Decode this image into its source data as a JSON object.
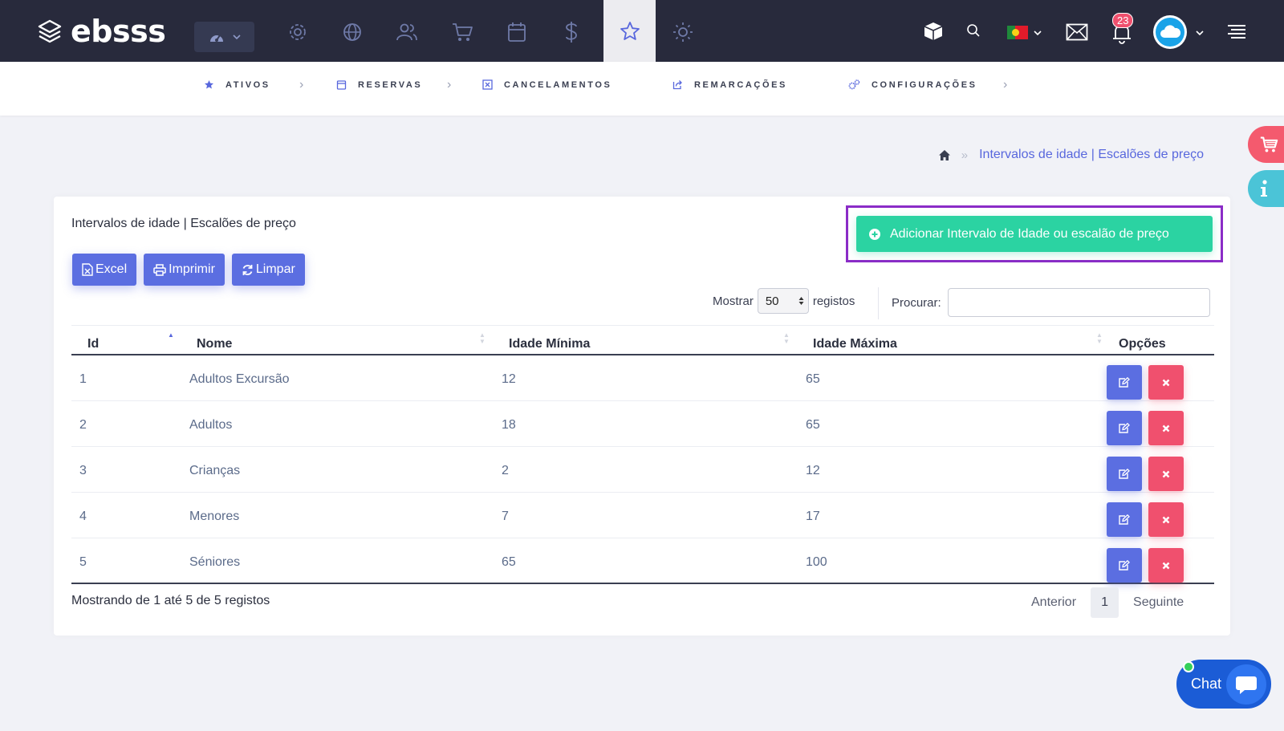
{
  "brand": {
    "name": "ebsss"
  },
  "topbar": {
    "icons": [
      "dashboard-icon",
      "gear-icon",
      "globe-icon",
      "users-icon",
      "cart-icon",
      "calendar-icon",
      "dollar-icon",
      "star-icon",
      "sun-icon"
    ],
    "active": "star-icon",
    "notifications_count": "23"
  },
  "subnav": {
    "items": [
      {
        "label": "ATIVOS",
        "icon": "star-icon"
      },
      {
        "label": "RESERVAS",
        "icon": "calendar-icon"
      },
      {
        "label": "CANCELAMENTOS",
        "icon": "cancel-icon"
      },
      {
        "label": "REMARCAÇÕES",
        "icon": "share-icon"
      },
      {
        "label": "CONFIGURAÇÕES",
        "icon": "cogs-icon"
      }
    ]
  },
  "breadcrumb": {
    "current": "Intervalos de idade | Escalões de preço"
  },
  "card": {
    "title": "Intervalos de idade | Escalões de preço",
    "add_button": "Adicionar Intervalo de Idade ou escalão de preço",
    "tools": {
      "excel": "Excel",
      "print": "Imprimir",
      "clear": "Limpar"
    },
    "show_label": "Mostrar",
    "show_value": "50",
    "show_suffix": "registos",
    "search_label": "Procurar:",
    "search_value": ""
  },
  "table": {
    "headers": {
      "id": "Id",
      "name": "Nome",
      "min": "Idade Mínima",
      "max": "Idade Máxima",
      "options": "Opções"
    },
    "rows": [
      {
        "id": "1",
        "name": "Adultos Excursão",
        "min": "12",
        "max": "65"
      },
      {
        "id": "2",
        "name": "Adultos",
        "min": "18",
        "max": "65"
      },
      {
        "id": "3",
        "name": "Crianças",
        "min": "2",
        "max": "12"
      },
      {
        "id": "4",
        "name": "Menores",
        "min": "7",
        "max": "17"
      },
      {
        "id": "5",
        "name": "Séniores",
        "min": "65",
        "max": "100"
      }
    ]
  },
  "footer": {
    "info": "Mostrando de 1 até 5 de 5 registos",
    "prev": "Anterior",
    "page": "1",
    "next": "Seguinte"
  },
  "chat": {
    "label": "Chat"
  },
  "colors": {
    "topbar": "#282a3c",
    "primary": "#5b6ee1",
    "success": "#2bd3a2",
    "danger": "#f0506e",
    "highlight": "#8b2cc7"
  }
}
